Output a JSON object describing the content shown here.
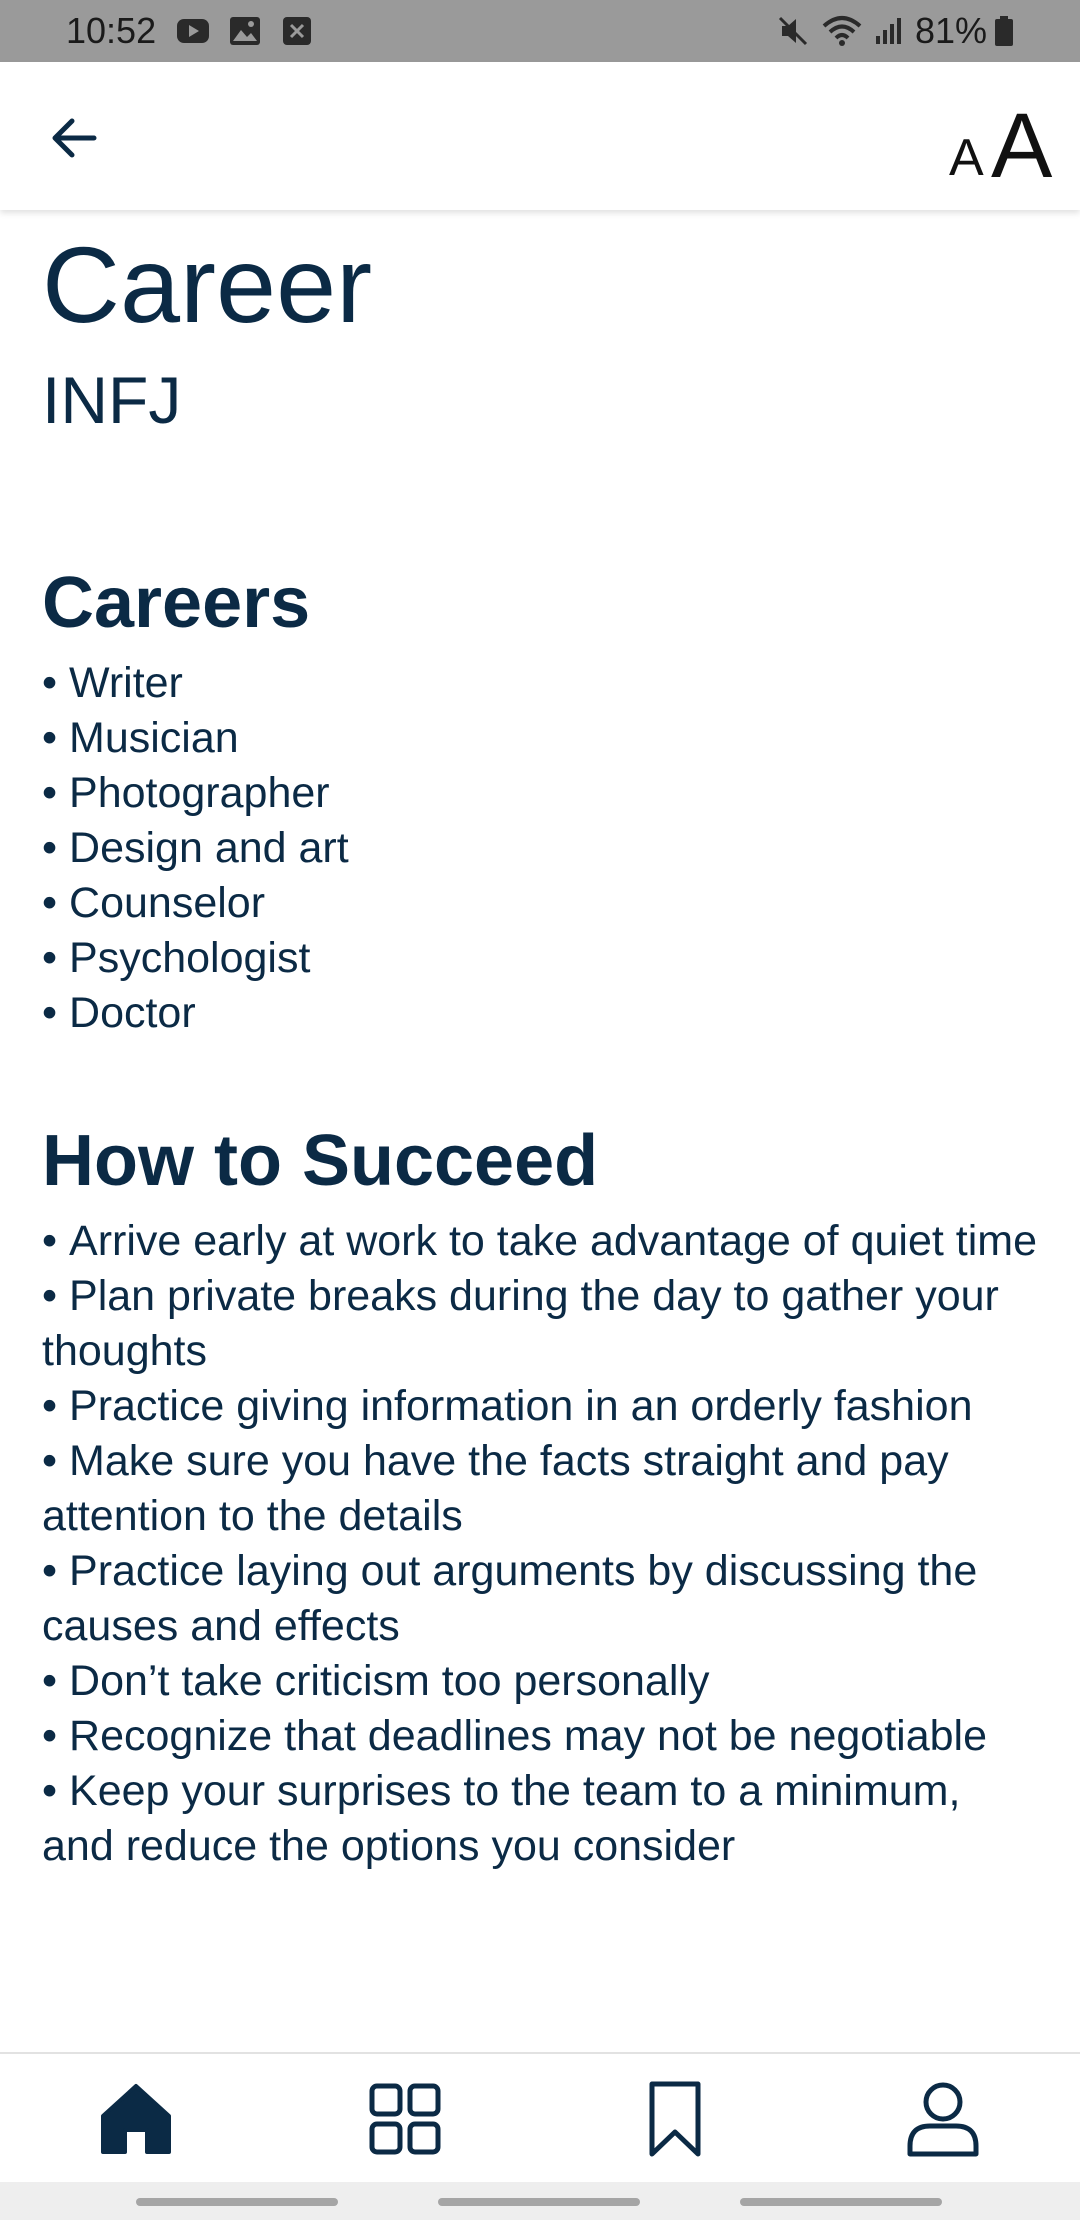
{
  "status_bar": {
    "time": "10:52",
    "battery": "81%",
    "icons": [
      "youtube-icon",
      "gallery-icon",
      "notification-icon",
      "mute-icon",
      "wifi-icon",
      "signal-icon",
      "battery-icon"
    ]
  },
  "app_bar": {
    "back_icon": "arrow-left-icon",
    "font_small": "A",
    "font_large": "A"
  },
  "page": {
    "title": "Career",
    "subtitle": "INFJ"
  },
  "careers": {
    "heading": "Careers",
    "items": [
      "Writer",
      "Musician",
      "Photographer",
      "Design and art",
      "Counselor",
      "Psychologist",
      "Doctor"
    ]
  },
  "succeed": {
    "heading": "How to Succeed",
    "items": [
      "Arrive early at work to take advantage of quiet time",
      "Plan private breaks during the day to gather your thoughts",
      "Practice giving information in an orderly fashion",
      "Make sure you have the facts straight and pay attention to the details",
      "Practice laying out arguments by discussing the causes and effects",
      "Don’t take criticism too personally",
      "Recognize that deadlines may not be negotiable",
      "Keep your surprises to the team to a minimum, and reduce the options you consider"
    ]
  },
  "bottom_nav": {
    "items": [
      "home-icon",
      "grid-icon",
      "bookmark-icon",
      "profile-icon"
    ],
    "active_color": "#0b2a45"
  }
}
